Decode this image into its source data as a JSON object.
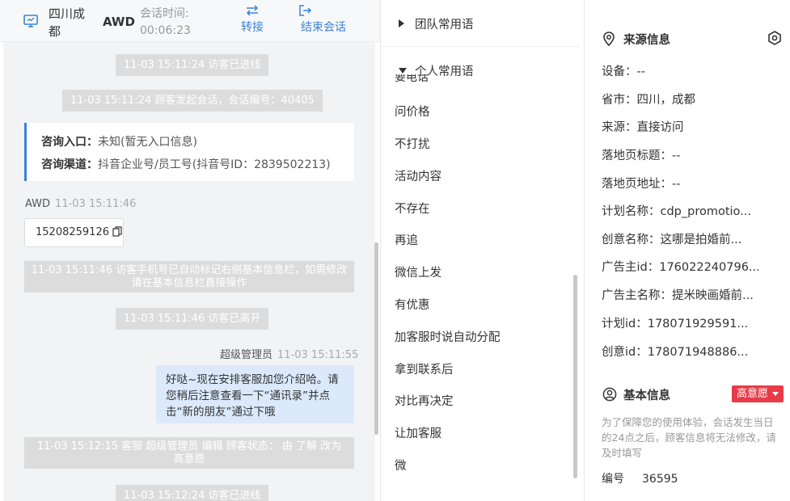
{
  "chat": {
    "header": {
      "location": "四川成都",
      "visitor_name": "AWD",
      "session_time_label": "会话时间:",
      "session_time_value": "00:06:23",
      "transfer_label": "转接",
      "end_label": "结束会话"
    },
    "messages": {
      "sys1": "11-03 15:11:24 访客已进线",
      "sys2": "11-03 15:11:24 顾客发起会话，会话编号：40405",
      "consult_entry_label": "咨询入口：",
      "consult_entry_value": "未知(暂无入口信息)",
      "consult_channel_label": "咨询渠道：",
      "consult_channel_value": "抖音企业号/员工号(抖音号ID：2839502213)",
      "visitor_sender": "AWD",
      "visitor_time": "11-03 15:11:46",
      "visitor_phone": "15208259126",
      "sys3": "11-03 15:11:46 访客手机号已自动标记右侧基本信息栏，如需修改请在基本信息栏直接操作",
      "sys4": "11-03 15:11:46 访客已离开",
      "agent_sender": "超级管理员",
      "agent_time": "11-03 15:11:55",
      "agent_message": "好哒~现在安排客服加您介绍哈。请您稍后注意查看一下“通讯录”并点击“新的朋友”通过下哦",
      "sys5": "11-03 15:12:15 客服 超级管理员 编辑 顾客状态： 由 了解 改为 高意愿",
      "sys6": "11-03 15:12:24 访客已进线"
    }
  },
  "phrases": {
    "team_group": "团队常用语",
    "personal_group": "个人常用语",
    "clipped_item": "要电话",
    "items": [
      "问价格",
      "不打扰",
      "活动内容",
      "不存在",
      "再追",
      "微信上发",
      "有优惠",
      "加客服时说自动分配",
      "拿到联系后",
      "对比再决定",
      "让加客服",
      "微"
    ]
  },
  "info": {
    "source_title": "来源信息",
    "source_rows": [
      "设备：--",
      "省市：四川，成都",
      "来源：直接访问",
      "落地页标题：--",
      "落地页地址：--",
      "计划名称：cdp_promotio...",
      "创意名称：这哪是拍婚前...",
      "广告主id：176022240796...",
      "广告主名称：提米映画婚前...",
      "计划id：178071929591...",
      "创意id：178071948886..."
    ],
    "basic_title": "基本信息",
    "intent_tag": "高意愿",
    "notice": "为了保障您的使用体验，会话发生当日的24点之后，顾客信息将无法修改，请及时填写",
    "id_label": "编号",
    "id_value": "36595"
  },
  "colors": {
    "accent": "#3b82d6",
    "tag_red": "#e83b48",
    "agent_bubble": "#dbe9fb",
    "system_message": "#dcdcdc"
  }
}
